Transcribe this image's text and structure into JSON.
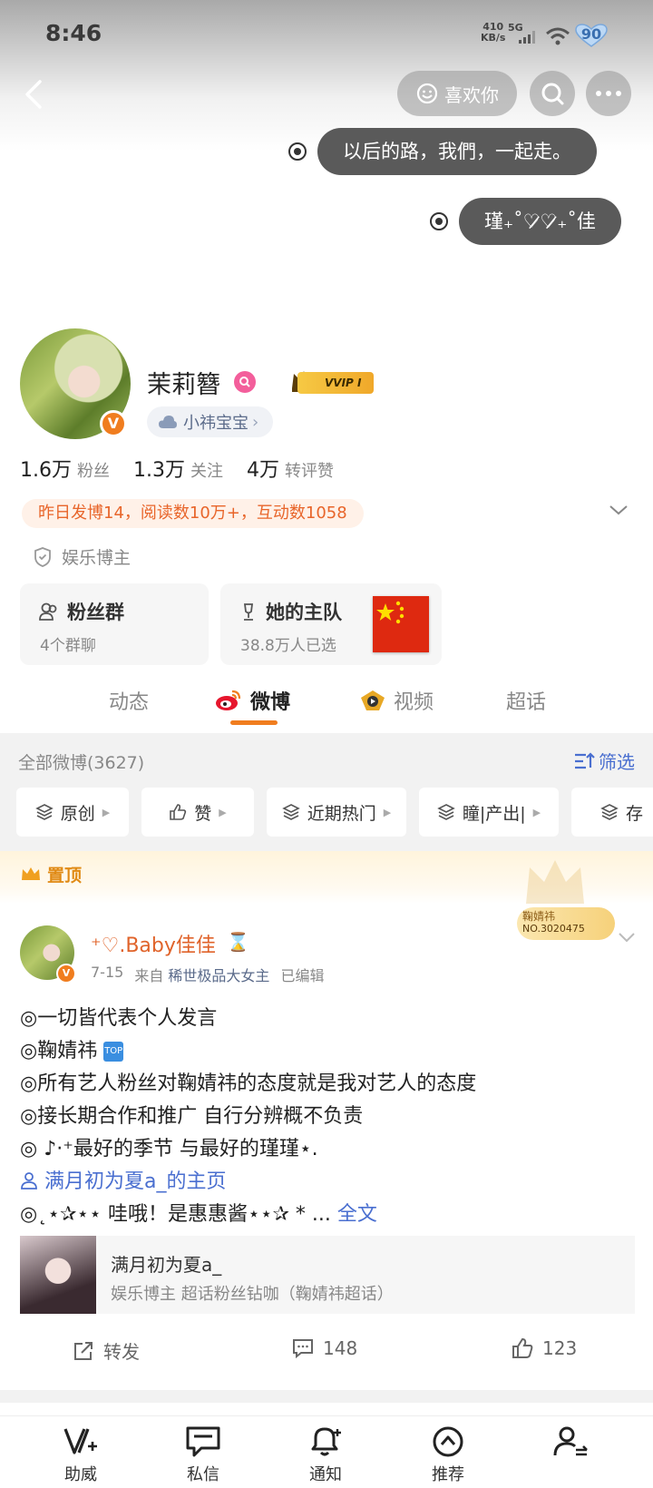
{
  "status": {
    "time": "8:46",
    "net_speed_line1": "410",
    "net_speed_line2": "KB/s",
    "network": "5G",
    "battery": "90"
  },
  "nav": {
    "like_label": "喜欢你"
  },
  "bubbles": {
    "first": "以后的路，我們，一起走。",
    "second": "瑾₊˚♡̷̷♡̷̷₊˚佳"
  },
  "profile": {
    "name": "茉莉簪",
    "vip_label": "VVIP Ⅰ",
    "fan_club": "小祎宝宝",
    "stats": [
      {
        "num": "1.6万",
        "label": "粉丝"
      },
      {
        "num": "1.3万",
        "label": "关注"
      },
      {
        "num": "4万",
        "label": "转评赞"
      }
    ],
    "activity": "昨日发博14，阅读数10万+，互动数1058",
    "role": "娱乐博主"
  },
  "cards": {
    "fans_group_title": "粉丝群",
    "fans_group_sub": "4个群聊",
    "team_title": "她的主队",
    "team_sub": "38.8万人已选"
  },
  "tabs": [
    "动态",
    "微博",
    "视频",
    "超话"
  ],
  "feed": {
    "count_label": "全部微博(3627)",
    "filter_label": "筛选",
    "chips": [
      "原创",
      "赞",
      "近期热门",
      "瞳|产出|",
      "存"
    ]
  },
  "pinned": {
    "label": "置顶"
  },
  "post": {
    "author": "⁺♡.Baby佳佳",
    "hourglass": "⌛",
    "date": "7-15",
    "from_prefix": "来自",
    "source": "稀世极品大女主",
    "edited": "已编辑",
    "fan_badge_name": "鞠婧祎",
    "fan_badge_no": "NO.3020475",
    "lines": [
      "◎一切皆代表个人发言",
      "◎鞠婧祎",
      "◎所有艺人粉丝对鞠婧祎的态度就是我对艺人的态度",
      "◎接长期合作和推广 自行分辨概不负责",
      "◎ ♪·⁺最好的季节 与最好的瑾瑾⋆.",
      "满月初为夏a_的主页",
      "◎˛⋆✰⋆⋆ 哇哦！是惠惠酱⋆⋆✰ * ..."
    ],
    "top_icon": "TOP",
    "fulltext": "全文",
    "ref_title": "满月初为夏a_",
    "ref_sub": "娱乐博主 超话粉丝钻咖（鞠婧祎超话）",
    "repost": "转发",
    "comments": "148",
    "likes": "123"
  },
  "bottom_nav": [
    "助威",
    "私信",
    "通知",
    "推荐",
    ""
  ]
}
